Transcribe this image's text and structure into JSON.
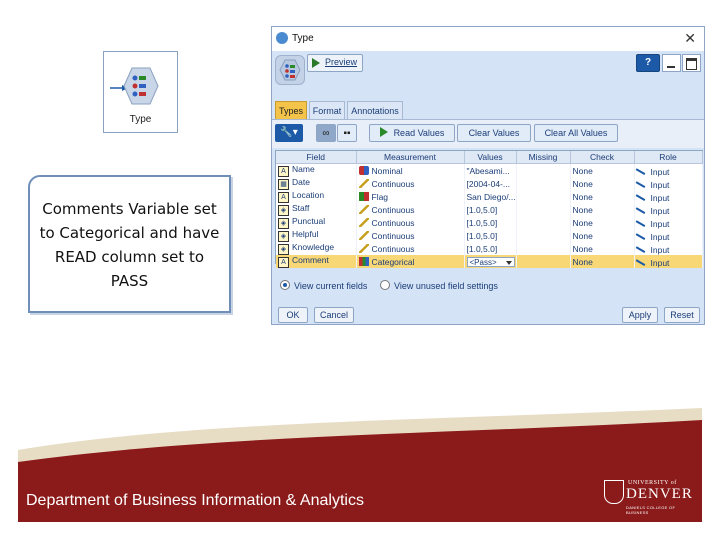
{
  "node": {
    "label": "Type"
  },
  "callout": {
    "text": "Comments Variable set to Categorical and have READ column set to PASS"
  },
  "dialog": {
    "title": "Type",
    "close_glyph": "✕",
    "preview_label": "Preview",
    "help_glyph": "?",
    "tabs": [
      "Types",
      "Format",
      "Annotations"
    ],
    "toolbar": {
      "wrench_glyph": "🔧▾",
      "toggle_a": "∞",
      "toggle_b": "▪▪",
      "read_values": "Read Values",
      "clear_values": "Clear Values",
      "clear_all_values": "Clear All Values"
    },
    "columns": [
      "Field",
      "Measurement",
      "Values",
      "Missing",
      "Check",
      "Role"
    ],
    "rows": [
      {
        "field": "Name",
        "type_icon": "A",
        "measurement": "Nominal",
        "measure_icon": "nominal",
        "values": "\"Abesami...",
        "missing": "",
        "check": "None",
        "role": "Input"
      },
      {
        "field": "Date",
        "type_icon": "▦",
        "measurement": "Continuous",
        "measure_icon": "continuous",
        "values": "[2004-04-...",
        "missing": "",
        "check": "None",
        "role": "Input"
      },
      {
        "field": "Location",
        "type_icon": "A",
        "measurement": "Flag",
        "measure_icon": "flag",
        "values": "San Diego/...",
        "missing": "",
        "check": "None",
        "role": "Input"
      },
      {
        "field": "Staff",
        "type_icon": "◈",
        "measurement": "Continuous",
        "measure_icon": "continuous",
        "values": "[1.0,5.0]",
        "missing": "",
        "check": "None",
        "role": "Input"
      },
      {
        "field": "Punctual",
        "type_icon": "◈",
        "measurement": "Continuous",
        "measure_icon": "continuous",
        "values": "[1.0,5.0]",
        "missing": "",
        "check": "None",
        "role": "Input"
      },
      {
        "field": "Helpful",
        "type_icon": "◈",
        "measurement": "Continuous",
        "measure_icon": "continuous",
        "values": "[1.0,5.0]",
        "missing": "",
        "check": "None",
        "role": "Input"
      },
      {
        "field": "Knowledge",
        "type_icon": "◈",
        "measurement": "Continuous",
        "measure_icon": "continuous",
        "values": "[1.0,5.0]",
        "missing": "",
        "check": "None",
        "role": "Input"
      },
      {
        "field": "Comment",
        "type_icon": "A",
        "measurement": "Categorical",
        "measure_icon": "categorical",
        "values": "<Pass>",
        "missing": "",
        "check": "None",
        "role": "Input",
        "selected": true,
        "values_dropdown": true
      }
    ],
    "radio_current": "View current fields",
    "radio_unused": "View unused field settings",
    "ok": "OK",
    "cancel": "Cancel",
    "apply": "Apply",
    "reset": "Reset"
  },
  "footer": {
    "department": "Department of Business Information & Analytics",
    "logo_top": "UNIVERSITY of",
    "logo_main": "DENVER",
    "logo_sub": "DANIELS COLLEGE OF BUSINESS",
    "colors": {
      "band": "#8b1a1a",
      "swoosh": "#e7dcc4"
    }
  }
}
